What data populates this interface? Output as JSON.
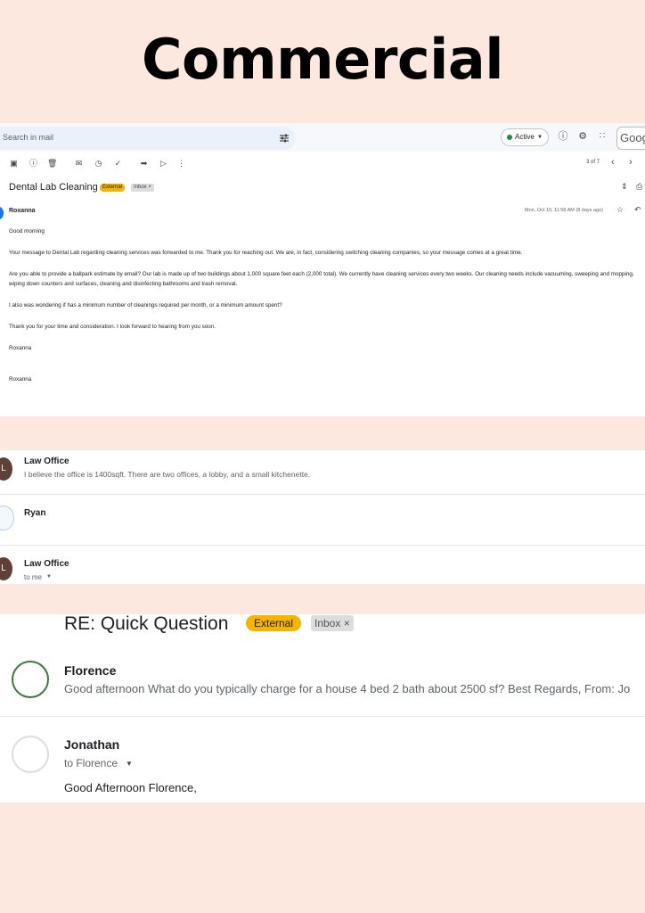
{
  "title": "Commercial",
  "gmail": {
    "search_placeholder": "Search in mail",
    "status": "Active",
    "brand_partial": "Goog",
    "pager": "3 of 7"
  },
  "email1": {
    "subject": "Dental Lab Cleaning",
    "badge_external": "External",
    "badge_inbox": "Inbox ×",
    "sender": "Roxanna",
    "date": "Mon, Oct 10, 11:58 AM (8 days ago)",
    "paragraphs": [
      "Good morning",
      "Your message to        Dental Lab regarding cleaning services was forwarded to me. Thank you for reaching out. We are, in fact, considering switching cleaning companies, so your message comes at a great time.",
      "Are you able to provide a ballpark estimate by email? Our lab is made up of two buildings about 1,000 square feet each (2,000 total). We currently have cleaning services every two weeks. Our cleaning needs include vacuuming, sweeping and mopping, wiping down counters and surfaces, cleaning and disinfecting bathrooms and trash removal.",
      "I also was wondering if                                   has a minimum number of cleanings required per month, or a minimum amount spent?",
      "Thank you for your time and consideration. I look forward to hearing from you soon.",
      "Roxanna",
      "Roxanna"
    ]
  },
  "thread2": {
    "msg1_name": "Law Office",
    "msg1_snippet": "I believe the office is 1400sqft. There are two offices, a lobby, and a small kitchenette.",
    "msg2_name": "Ryan",
    "msg3_name": "Law Office",
    "msg3_to": "to me",
    "avatar_letter": "L"
  },
  "thread3": {
    "subject": "RE: Quick Question",
    "badge_external": "External",
    "badge_inbox": "Inbox ×",
    "msg1_name": "Florence",
    "msg1_snippet": "Good afternoon What do you typically charge for a house 4 bed 2 bath about 2500 sf? Best Regards, From: Jo",
    "msg2_name": "Jonathan",
    "msg2_to": "to Florence",
    "msg2_greeting": "Good Afternoon Florence,"
  }
}
